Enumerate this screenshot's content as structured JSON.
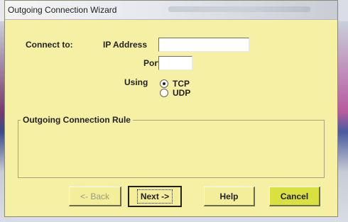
{
  "window": {
    "title": "Outgoing Connection Wizard"
  },
  "form": {
    "connect_label": "Connect to:",
    "ip_label": "IP Address",
    "ip_value": "",
    "port_label": "Port",
    "port_value": "",
    "using_label": "Using",
    "protocol_options": [
      {
        "label": "TCP",
        "selected": true
      },
      {
        "label": "UDP",
        "selected": false
      }
    ]
  },
  "rule_group": {
    "title": "Outgoing Connection Rule"
  },
  "buttons": {
    "back": "<- Back",
    "next": "Next ->",
    "help": "Help",
    "cancel": "Cancel"
  },
  "colors": {
    "dialog_background": "#f6f0a4",
    "cancel_background": "#d9e040"
  }
}
